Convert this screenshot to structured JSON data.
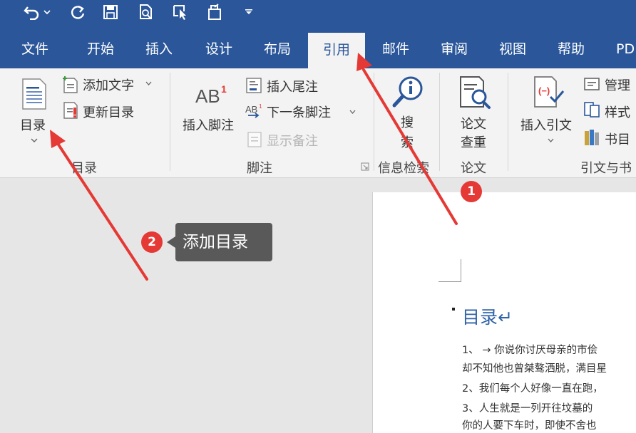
{
  "tabs": [
    {
      "label": "文件",
      "active": false
    },
    {
      "label": "开始",
      "active": false
    },
    {
      "label": "插入",
      "active": false
    },
    {
      "label": "设计",
      "active": false
    },
    {
      "label": "布局",
      "active": false
    },
    {
      "label": "引用",
      "active": true
    },
    {
      "label": "邮件",
      "active": false
    },
    {
      "label": "审阅",
      "active": false
    },
    {
      "label": "视图",
      "active": false
    },
    {
      "label": "帮助",
      "active": false
    },
    {
      "label": "PD",
      "active": false
    }
  ],
  "ribbon": {
    "toc": {
      "toc_button": "目录",
      "add_text": "添加文字",
      "update_toc": "更新目录",
      "group_label": "目录"
    },
    "footnotes": {
      "insert_footnote": "插入脚注",
      "insert_endnote": "插入尾注",
      "next_footnote": "下一条脚注",
      "show_notes": "显示备注",
      "group_label": "脚注"
    },
    "research": {
      "search_line1": "搜",
      "search_line2": "索",
      "group_label": "信息检索"
    },
    "paper": {
      "check_line1": "论文",
      "check_line2": "查重",
      "group_label": "论文"
    },
    "citations": {
      "insert_citation": "插入引文",
      "manage": "管理",
      "style": "样式",
      "bibliography": "书目",
      "group_label": "引文与书"
    }
  },
  "document": {
    "toc_title": "目录↵",
    "lines": [
      "1、 → 你说你讨厌母亲的市侩",
      "却不知他也曾桀骜洒脱，满目星",
      "2、我们每个人好像一直在跑，",
      "3、人生就是一列开往坟墓的",
      "你的人要下车时，即使不舍也"
    ]
  },
  "annotations": {
    "badge1": "1",
    "badge2": "2",
    "tooltip": "添加目录",
    "color": "#e53935"
  },
  "colors": {
    "title_bar": "#2b579a",
    "ribbon_bg": "#f3f3f3",
    "canvas_bg": "#e6e6e6",
    "heading": "#2f63a8"
  }
}
